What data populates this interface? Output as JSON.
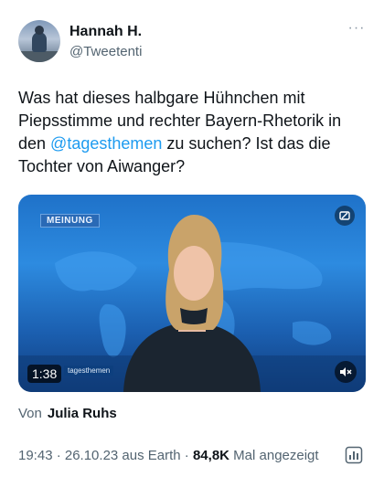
{
  "author": {
    "name": "Hannah H.",
    "handle": "@Tweetenti",
    "more_icon": "more-dots-icon"
  },
  "tweet": {
    "text_before": "Was hat dieses halbgare Hühnchen  mit Piepsstimme und rechter Bayern-Rhetorik in den ",
    "mention": "@tagesthemen",
    "text_after": " zu suchen? Ist das die Tochter von Aiwanger?"
  },
  "media": {
    "badge": "MEINUNG",
    "duration": "1:38",
    "logo_text": "tagesthemen",
    "corner_icon": "picture-in-picture-icon",
    "mute_icon": "speaker-muted-icon"
  },
  "credit": {
    "prefix": "Von",
    "name": "Julia Ruhs"
  },
  "meta": {
    "time_date": "19:43 · 26.10.23 aus Earth · ",
    "views": "84,8K",
    "views_suffix": " Mal angezeigt",
    "stats_icon": "post-analytics-icon"
  },
  "colors": {
    "link": "#1d9bf0",
    "text": "#0f1419",
    "muted": "#536471"
  }
}
